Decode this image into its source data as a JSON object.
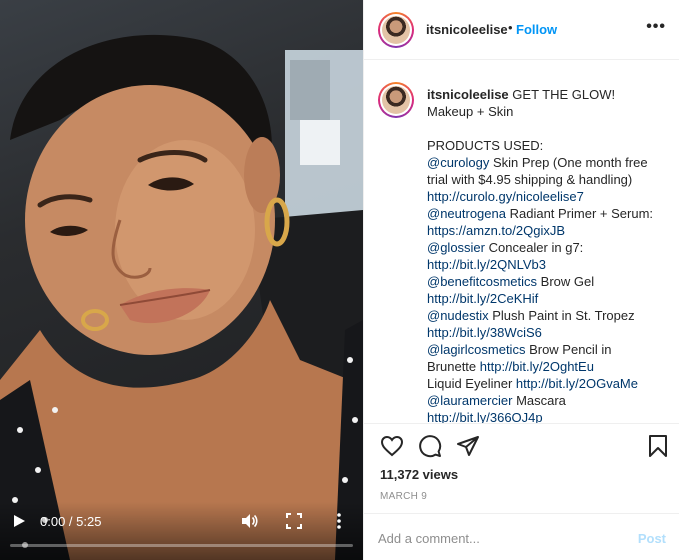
{
  "video": {
    "time_display": "0:00 / 5:25",
    "progress": 0.0,
    "controls": {
      "play_icon": "play-icon",
      "volume_icon": "volume-icon",
      "fullscreen_icon": "fullscreen-icon",
      "more_icon": "more-vertical-icon"
    }
  },
  "header": {
    "username": "itsnicoleelise",
    "separator": "•",
    "follow_label": "Follow",
    "more_label": "•••"
  },
  "caption": {
    "username": "itsnicoleelise",
    "title": "GET THE GLOW! Makeup + Skin",
    "products_heading": "PRODUCTS USED:",
    "lines": [
      {
        "mention": "@curology",
        "text": " Skin Prep (One month free trial with $4.95 shipping & handling) ",
        "link": "http://curolo.gy/nicoleelise7"
      },
      {
        "mention": "@neutrogena",
        "text": " Radiant Primer + Serum: ",
        "link": "https://amzn.to/2QgixJB"
      },
      {
        "mention": "@glossier",
        "text": " Concealer in g7: ",
        "link": "http://bit.ly/2QNLVb3"
      },
      {
        "mention": "@benefitcosmetics",
        "text": " Brow Gel ",
        "link": "http://bit.ly/2CeKHif"
      },
      {
        "mention": "@nudestix",
        "text": " Plush Paint in St. Tropez ",
        "link": "http://bit.ly/38WciS6"
      },
      {
        "mention": "@lagirlcosmetics",
        "text": " Brow Pencil in Brunette ",
        "link": "http://bit.ly/2OghtEu"
      },
      {
        "mention": "",
        "text": "Liquid Eyeliner ",
        "link": "http://bit.ly/2OGvaMe"
      },
      {
        "mention": "@lauramercier",
        "text": " Mascara ",
        "link": "http://bit.ly/366OJ4p"
      }
    ]
  },
  "actions": {
    "like_icon": "heart-icon",
    "comment_icon": "comment-icon",
    "share_icon": "share-icon",
    "save_icon": "bookmark-icon",
    "views": "11,372 views",
    "date": "MARCH 9"
  },
  "comment_box": {
    "placeholder": "Add a comment...",
    "post_label": "Post"
  },
  "colors": {
    "follow_blue": "#0095f6",
    "link_blue": "#00376b",
    "post_disabled": "#b2dffc",
    "secondary_text": "#8e8e8e"
  }
}
